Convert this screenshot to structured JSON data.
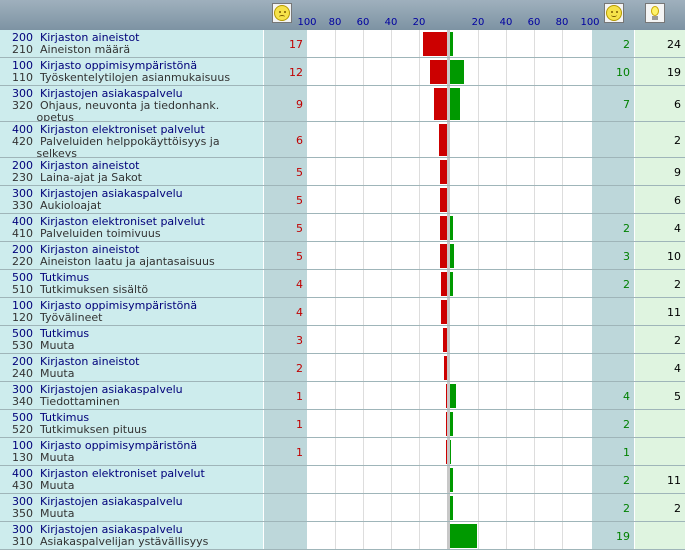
{
  "chart_data": {
    "type": "bar",
    "layout": "diverging-horizontal",
    "axis_left_ticks": [
      "100",
      "80",
      "60",
      "40",
      "20"
    ],
    "axis_right_ticks": [
      "20",
      "40",
      "60",
      "80",
      "100"
    ],
    "axis_range": [
      0,
      100
    ],
    "icons": [
      "sad-face-icon",
      "happy-face-icon",
      "lightbulb-icon"
    ],
    "colors": {
      "negative": "#cc0000",
      "positive": "#009900",
      "label_bg": "#cdeced"
    },
    "rows": [
      {
        "line1": "200  Kirjaston aineistot",
        "line2": "210  Aineiston määrä",
        "neg": 17,
        "pos": 2,
        "total": 24
      },
      {
        "line1": "100  Kirjasto oppimisympäristönä",
        "line2": "110  Työskentelytilojen asianmukaisuus",
        "neg": 12,
        "pos": 10,
        "total": 19
      },
      {
        "line1": "300  Kirjastojen asiakaspalvelu",
        "line2": "320  Ohjaus, neuvonta ja tiedonhank.",
        "line3": "       opetus",
        "neg": 9,
        "pos": 7,
        "total": 6
      },
      {
        "line1": "400  Kirjaston elektroniset palvelut",
        "line2": "420  Palveluiden helppokäyttöisyys ja",
        "line3": "       selkeys",
        "neg": 6,
        "pos": null,
        "total": 2
      },
      {
        "line1": "200  Kirjaston aineistot",
        "line2": "230  Laina-ajat ja Sakot",
        "neg": 5,
        "pos": null,
        "total": 9
      },
      {
        "line1": "300  Kirjastojen asiakaspalvelu",
        "line2": "330  Aukioloajat",
        "neg": 5,
        "pos": null,
        "total": 6
      },
      {
        "line1": "400  Kirjaston elektroniset palvelut",
        "line2": "410  Palveluiden toimivuus",
        "neg": 5,
        "pos": 2,
        "total": 4
      },
      {
        "line1": "200  Kirjaston aineistot",
        "line2": "220  Aineiston laatu ja ajantasaisuus",
        "neg": 5,
        "pos": 3,
        "total": 10
      },
      {
        "line1": "500  Tutkimus",
        "line2": "510  Tutkimuksen sisältö",
        "neg": 4,
        "pos": 2,
        "total": 2
      },
      {
        "line1": "100  Kirjasto oppimisympäristönä",
        "line2": "120  Työvälineet",
        "neg": 4,
        "pos": null,
        "total": 11
      },
      {
        "line1": "500  Tutkimus",
        "line2": "530  Muuta",
        "neg": 3,
        "pos": null,
        "total": 2
      },
      {
        "line1": "200  Kirjaston aineistot",
        "line2": "240  Muuta",
        "neg": 2,
        "pos": null,
        "total": 4
      },
      {
        "line1": "300  Kirjastojen asiakaspalvelu",
        "line2": "340  Tiedottaminen",
        "neg": 1,
        "pos": 4,
        "total": 5
      },
      {
        "line1": "500  Tutkimus",
        "line2": "520  Tutkimuksen pituus",
        "neg": 1,
        "pos": 2,
        "total": null
      },
      {
        "line1": "100  Kirjasto oppimisympäristönä",
        "line2": "130  Muuta",
        "neg": 1,
        "pos": 1,
        "total": null
      },
      {
        "line1": "400  Kirjaston elektroniset palvelut",
        "line2": "430  Muuta",
        "neg": null,
        "pos": 2,
        "total": 11
      },
      {
        "line1": "300  Kirjastojen asiakaspalvelu",
        "line2": "350  Muuta",
        "neg": null,
        "pos": 2,
        "total": 2
      },
      {
        "line1": "300  Kirjastojen asiakaspalvelu",
        "line2": "310  Asiakaspalvelijan ystävällisyys",
        "neg": null,
        "pos": 19,
        "total": null
      }
    ]
  }
}
